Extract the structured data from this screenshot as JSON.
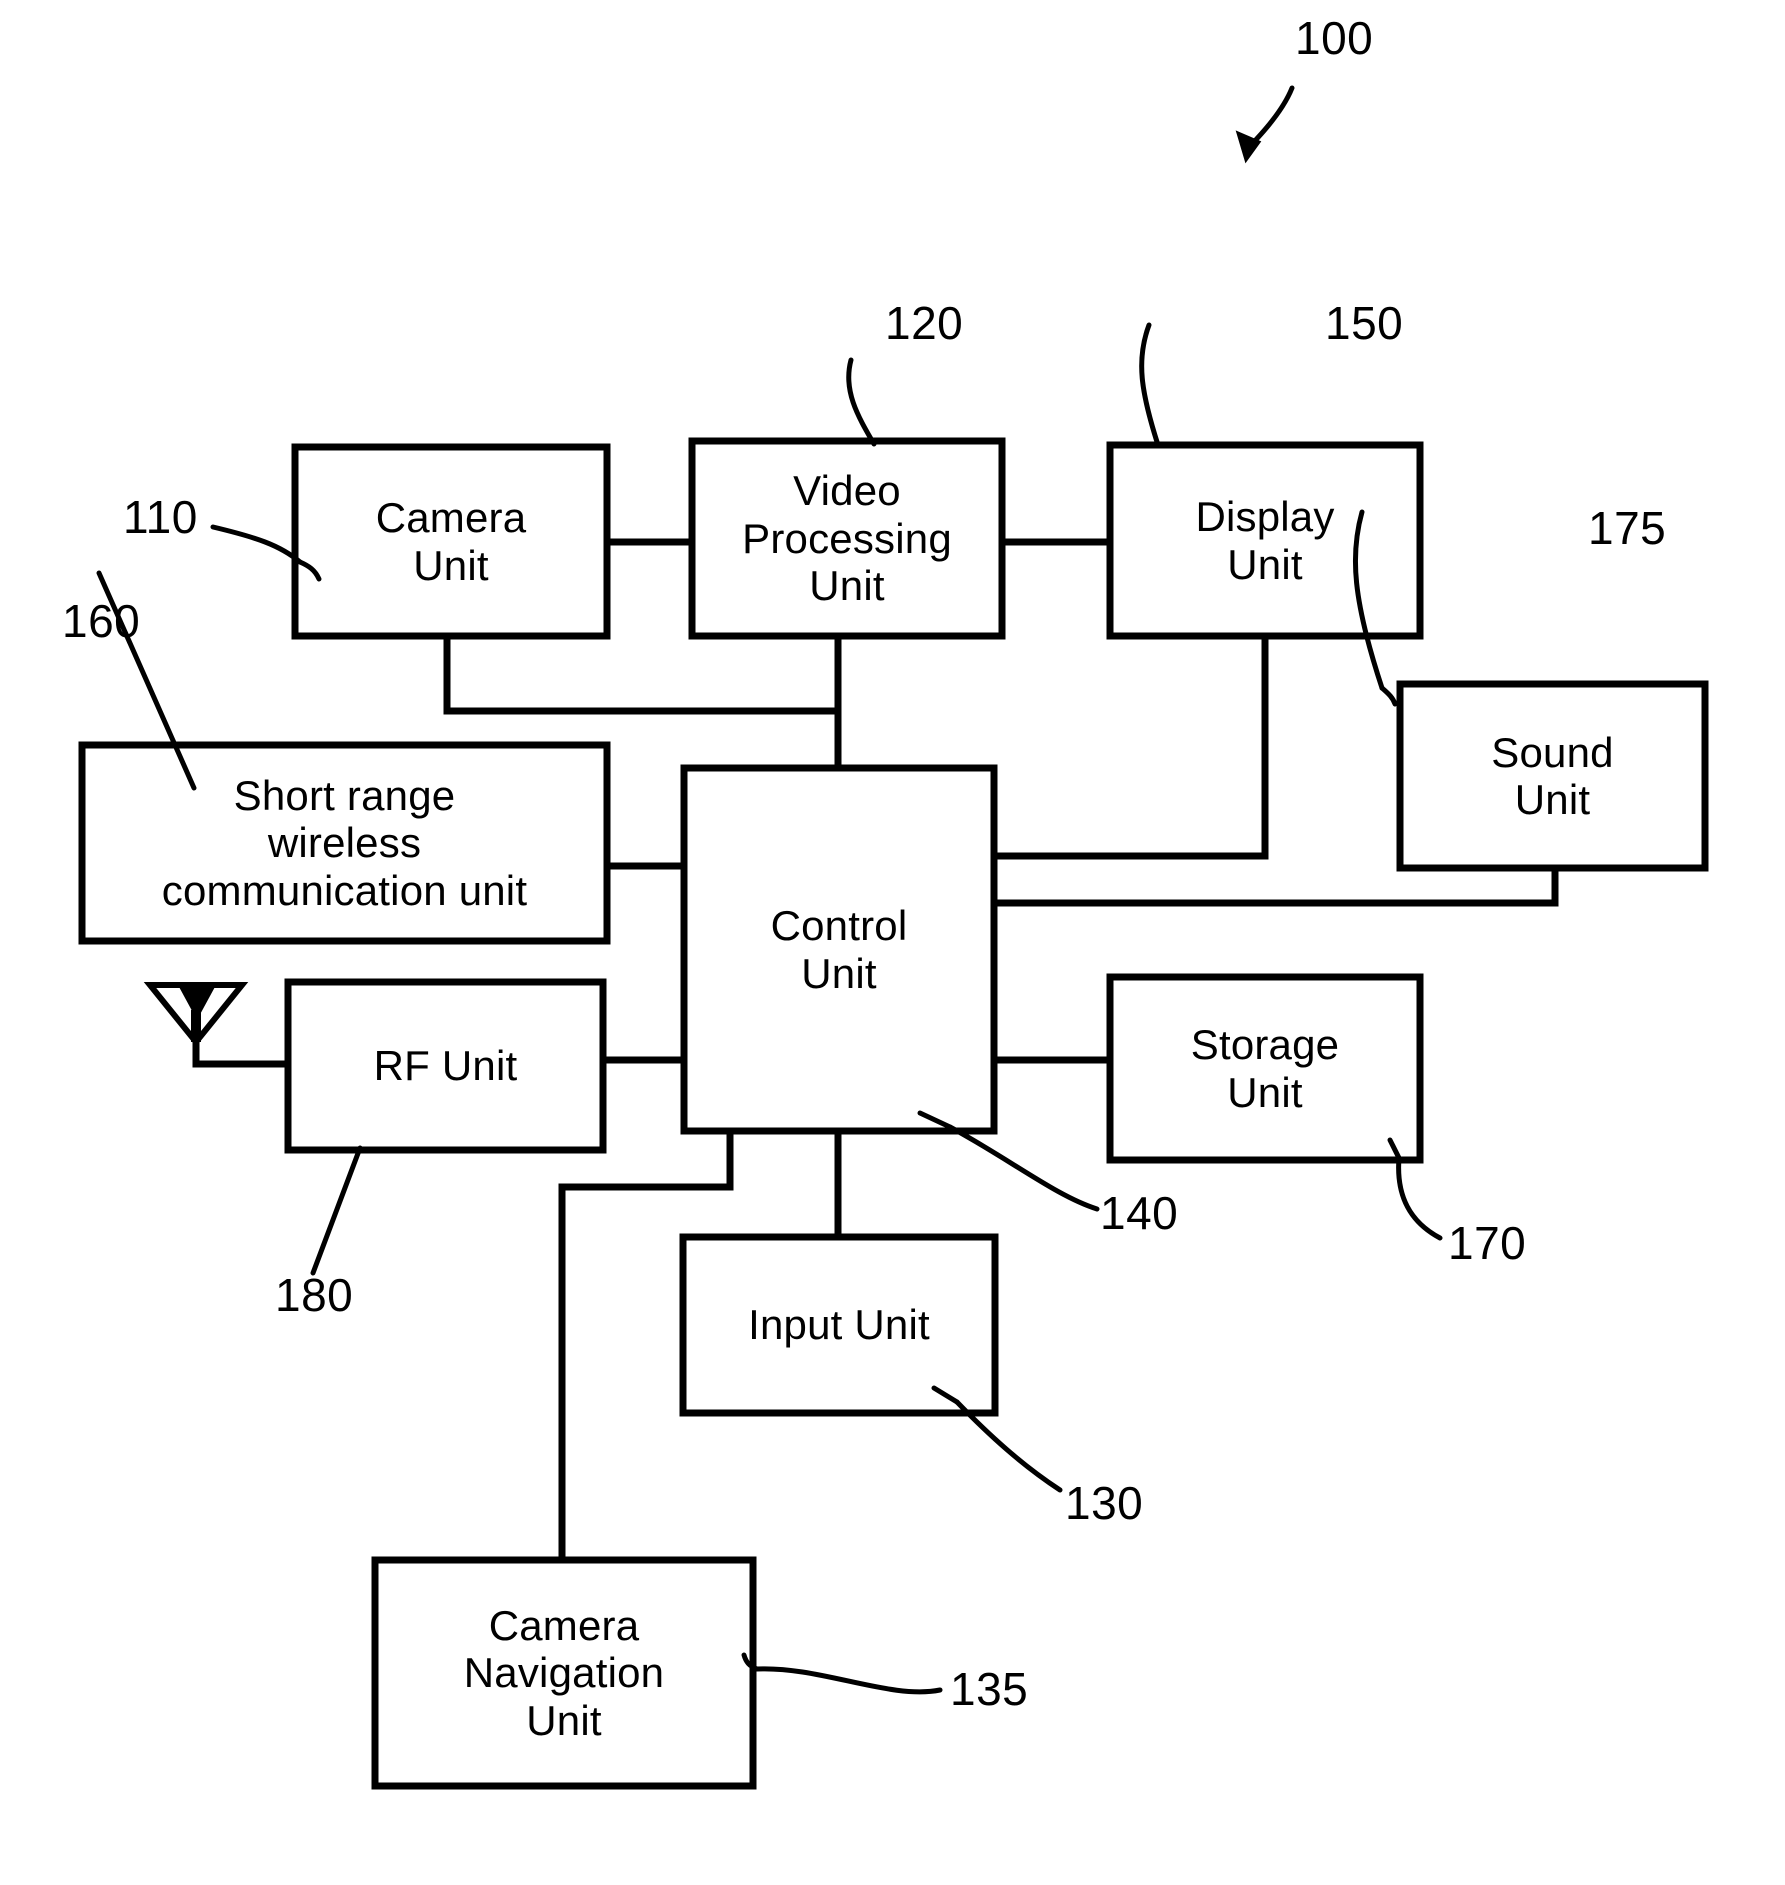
{
  "figure": {
    "figure_ref": "100",
    "blocks": [
      {
        "id": "camera-unit",
        "label": "Camera\nUnit",
        "ref": "110"
      },
      {
        "id": "video-processing",
        "label": "Video\nProcessing\nUnit",
        "ref": "120"
      },
      {
        "id": "display-unit",
        "label": "Display\nUnit",
        "ref": "150"
      },
      {
        "id": "sound-unit",
        "label": "Sound\nUnit",
        "ref": "175"
      },
      {
        "id": "short-range",
        "label": "Short range\nwireless\ncommunication unit",
        "ref": "160"
      },
      {
        "id": "control-unit",
        "label": "Control\nUnit",
        "ref": "140"
      },
      {
        "id": "rf-unit",
        "label": "RF Unit",
        "ref": "180"
      },
      {
        "id": "storage-unit",
        "label": "Storage\nUnit",
        "ref": "170"
      },
      {
        "id": "input-unit",
        "label": "Input Unit",
        "ref": "130"
      },
      {
        "id": "camera-navigation",
        "label": "Camera\nNavigation\nUnit",
        "ref": "135"
      }
    ],
    "reference_numbers": {
      "figure": "100",
      "camera_unit": "110",
      "video_processing_unit": "120",
      "input_unit": "130",
      "camera_navigation_unit": "135",
      "control_unit": "140",
      "display_unit": "150",
      "short_range_wireless_communication_unit": "160",
      "storage_unit": "170",
      "sound_unit": "175",
      "rf_unit": "180"
    },
    "icons": {
      "antenna": "antenna-icon",
      "figure_arrow": "figure-lead-arrow-icon"
    },
    "colors": {
      "stroke": "#000000",
      "background": "#ffffff"
    }
  }
}
